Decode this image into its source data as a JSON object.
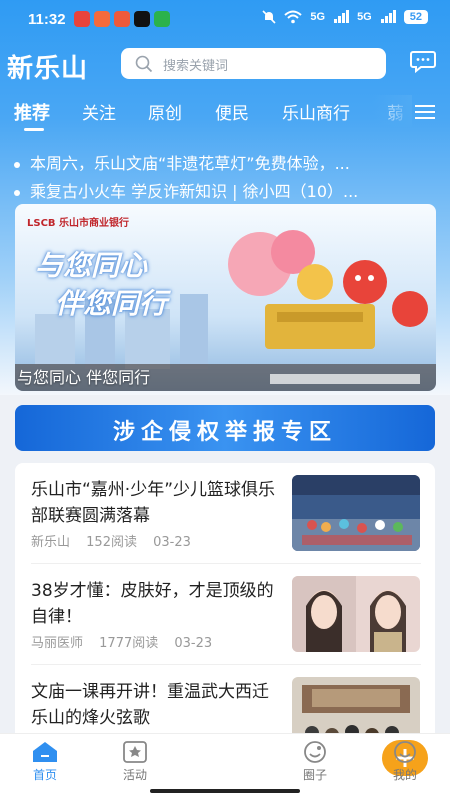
{
  "status": {
    "time": "11:32",
    "battery": "52",
    "signal1": "5G",
    "signal2": "5G"
  },
  "app": {
    "logo": "新乐山"
  },
  "search": {
    "placeholder": "搜索关键词"
  },
  "tabs": [
    {
      "label": "推荐",
      "active": true
    },
    {
      "label": "关注"
    },
    {
      "label": "原创"
    },
    {
      "label": "便民"
    },
    {
      "label": "乐山商行"
    },
    {
      "label": "蒻"
    }
  ],
  "news": [
    "本周六，乐山文庙“非遗花草灯”免费体验，...",
    "乘复古小火车 学反诈新知识 | 徐小四（10）..."
  ],
  "banner": {
    "bank_name": "LSCB 乐山市商业银行",
    "slogan_line1": "与您同心",
    "slogan_line2": "伴您同行",
    "caption": "与您同心 伴您同行"
  },
  "report": {
    "label": "涉企侵权举报专区"
  },
  "articles": [
    {
      "title": "乐山市“嘉州·少年”少儿篮球俱乐部联赛圆满落幕",
      "source": "新乐山",
      "reads": "152阅读",
      "date": "03-23"
    },
    {
      "title": "38岁才懂：皮肤好，才是顶级的自律！",
      "source": "马丽医师",
      "reads": "1777阅读",
      "date": "03-23"
    },
    {
      "title": "文庙一课再开讲！重温武大西迁乐山的烽火弦歌",
      "source": "",
      "reads": "",
      "date": ""
    }
  ],
  "nav": [
    {
      "label": "首页",
      "icon": "home-icon",
      "active": true
    },
    {
      "label": "活动",
      "icon": "activity-icon"
    },
    {
      "label": "",
      "icon": "plus-icon"
    },
    {
      "label": "圈子",
      "icon": "circle-icon"
    },
    {
      "label": "我的",
      "icon": "profile-icon"
    }
  ],
  "colors": {
    "primary": "#2f9bf3",
    "accent": "#f6a21a",
    "report": "#1567d8"
  }
}
